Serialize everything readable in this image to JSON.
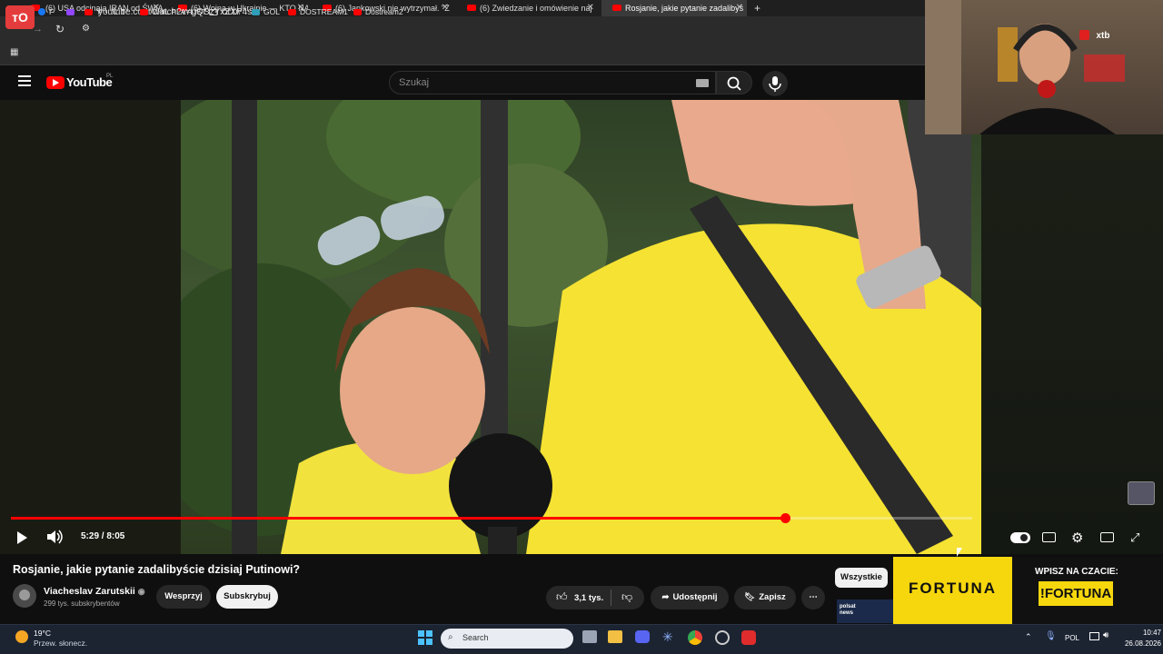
{
  "browser": {
    "tabs": [
      {
        "label": "(6) USA odcinają IRAN od ŚWIA",
        "active": false
      },
      {
        "label": "(6) Wojna w Ukrainie — KTO NA",
        "active": false
      },
      {
        "label": "(6) Jankowski nie wytrzymał. \"Z",
        "active": false
      },
      {
        "label": "(6) Zwiedzanie i omówienie naj",
        "active": false
      },
      {
        "label": "Rosjanie, jakie pytanie zadalibyś",
        "active": true
      }
    ],
    "new_tab": "+",
    "url": "youtube.com/watch?v=gQSzYxZXP4s",
    "bookmarks": [
      {
        "label": "F",
        "color": "#1877f2"
      },
      {
        "label": "",
        "color": "#9146ff"
      },
      {
        "label": "Y",
        "color": "#ff0000"
      },
      {
        "label": "T",
        "color": "#ffffff"
      },
      {
        "label": "CHIL PLAYLIST",
        "color": "#ff0000"
      },
      {
        "label": "OLD\\",
        "color": "#cfcfcf"
      },
      {
        "label": "GOL",
        "color": "#2f9fb8"
      },
      {
        "label": "DOSTREAM1",
        "color": "#ff0000"
      },
      {
        "label": "Dostream2",
        "color": "#ff0000"
      }
    ]
  },
  "youtube": {
    "logo": "YouTube",
    "region": "PL",
    "search_placeholder": "Szukaj"
  },
  "player": {
    "time": "5:29 / 8:05",
    "progress": 0.805
  },
  "webcam": {
    "sponsor": "xtb"
  },
  "video": {
    "title": "Rosjanie, jakie pytanie zadalibyście dzisiaj Putinowi?",
    "channel": "Viacheslav Zarutskii",
    "subscribers": "299 tys. subskrybentów",
    "support_label": "Wesprzyj",
    "subscribe_label": "Subskrybuj",
    "likes": "3,1 tys.",
    "share_label": "Udostępnij",
    "save_label": "Zapisz"
  },
  "sidebar": {
    "filter_label": "Wszystkie"
  },
  "ad": {
    "brand": "FORTUNA",
    "promo": "WPISZ NA CZACIE:",
    "code": "!FORTUNA",
    "small": "polsat news"
  },
  "taskbar": {
    "temp": "19°C",
    "weather": "Przew. słonecz.",
    "search": "Search",
    "lang": "POL",
    "time": "10:47",
    "date": "26.08.2026"
  },
  "colors": {
    "accent": "#ff0000",
    "fortuna": "#f6d70d"
  }
}
